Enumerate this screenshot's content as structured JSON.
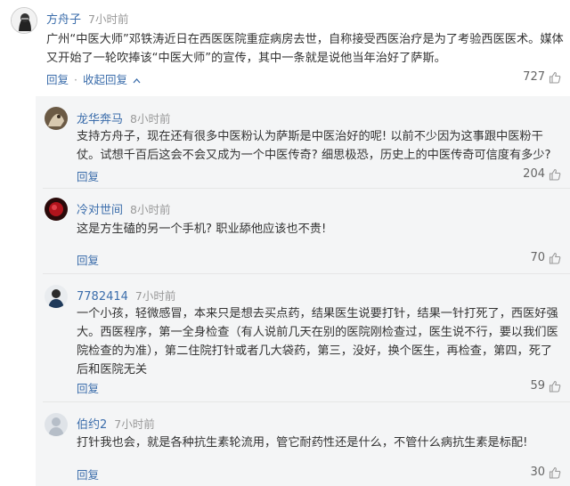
{
  "comments": [
    {
      "user": "方舟子",
      "time": "7小时前",
      "text": "广州“中医大师”邓铁涛近日在西医医院重症病房去世，自称接受西医治疗是为了考验西医医术。媒体又开始了一轮吹捧该“中医大师”的宣传，其中一条就是说他当年治好了萨斯。",
      "reply_label": "回复",
      "separator": "·",
      "collapse_label": "收起回复",
      "collapse_icon": "chevron-up-icon",
      "likes": "727"
    }
  ],
  "replies": [
    {
      "user": "龙华奔马",
      "time": "8小时前",
      "text": "支持方舟子，现在还有很多中医粉认为萨斯是中医治好的呢! 以前不少因为这事跟中医粉干仗。试想千百后这会不会又成为一个中医传奇? 细思极恐，历史上的中医传奇可信度有多少?",
      "reply_label": "回复",
      "likes": "204"
    },
    {
      "user": "冷对世间",
      "time": "8小时前",
      "text": "这是方生磕的另一个手机? 职业舔他应该也不贵!",
      "reply_label": "回复",
      "likes": "70"
    },
    {
      "user": "7782414",
      "time": "7小时前",
      "text": "一个小孩，轻微感冒，本来只是想去买点药，结果医生说要打针，结果一针打死了，西医好强大。西医程序，第一全身检查（有人说前几天在别的医院刚检查过，医生说不行，要以我们医院检查的为准），第二住院打针或者几大袋药，第三，没好，换个医生，再检查，第四，死了后和医院无关",
      "reply_label": "回复",
      "likes": "59"
    },
    {
      "user": "伯约2",
      "time": "7小时前",
      "text": "打针我也会，就是各种抗生素轮流用，管它耐药性还是什么，不管什么病抗生素是标配!",
      "reply_label": "回复",
      "likes": "30"
    }
  ],
  "icons": {
    "like": "thumbs-up-icon"
  },
  "colors": {
    "username": "#3b6dab",
    "meta": "#999999",
    "text": "#333333",
    "reply_background": "#f4f5f6"
  }
}
